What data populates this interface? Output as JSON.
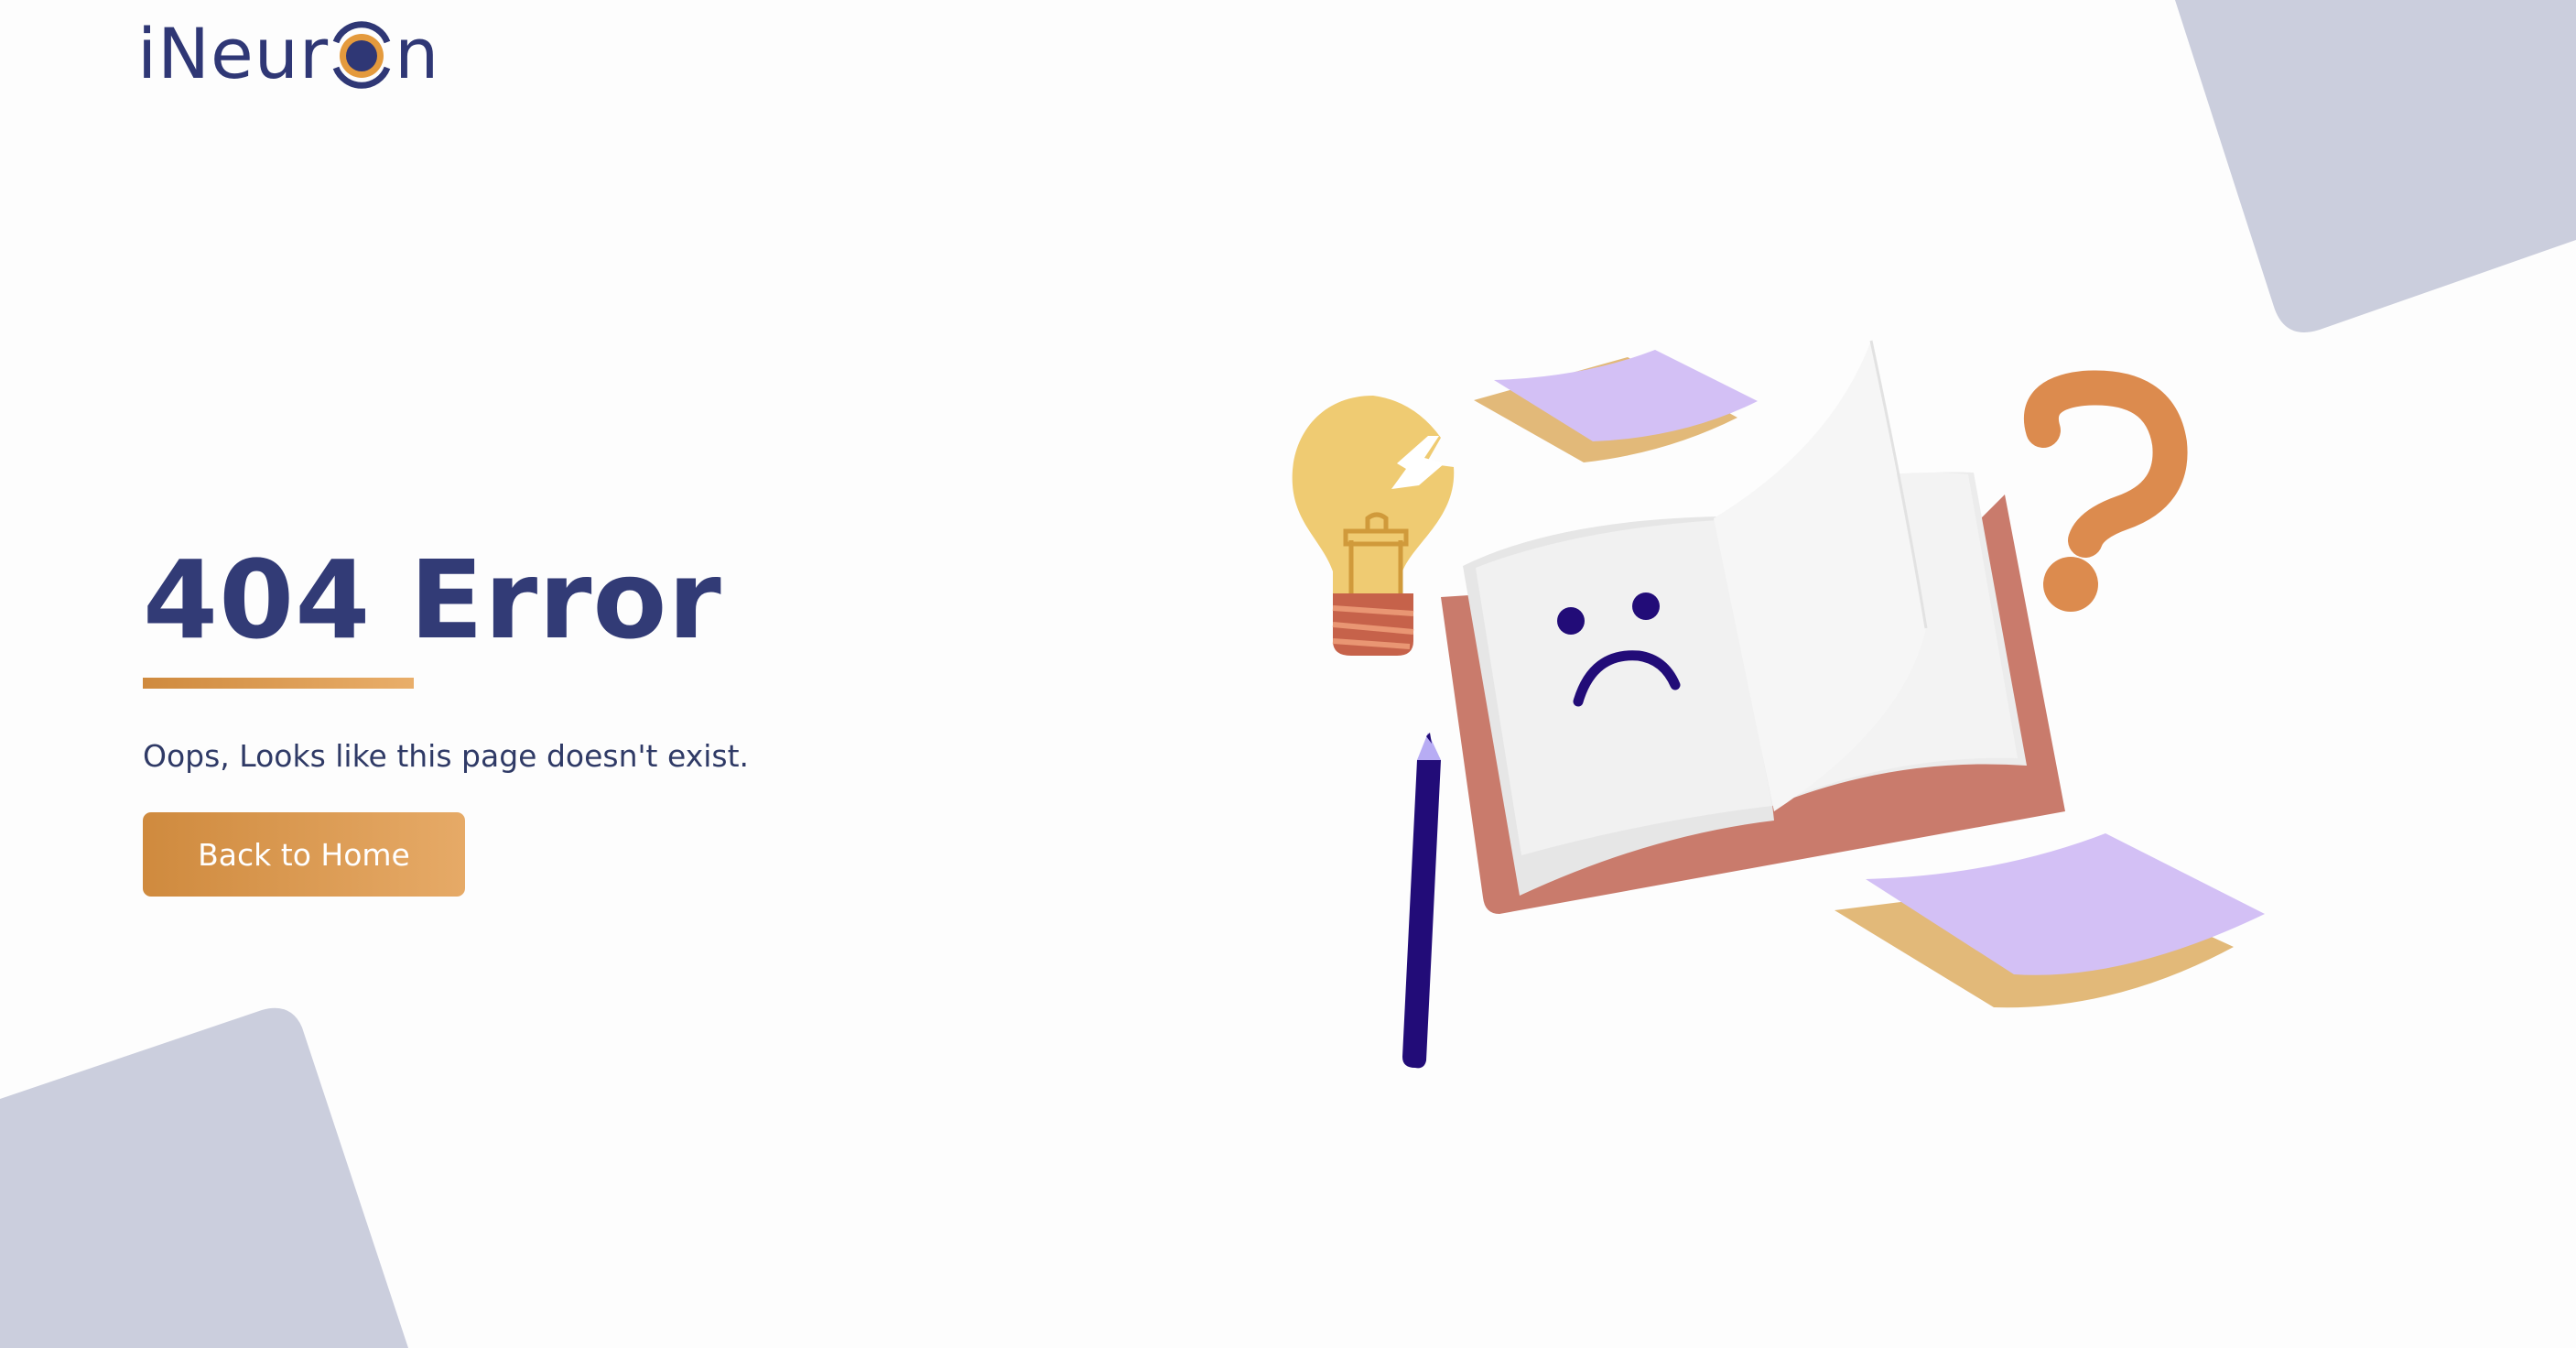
{
  "brand": {
    "logo_text_start": "iNeur",
    "logo_text_end": "n"
  },
  "error": {
    "title": "404 Error",
    "message": "Oops, Looks like this page doesn't exist.",
    "button_label": "Back to Home"
  },
  "colors": {
    "primary_text": "#323b76",
    "accent_start": "#cf8a3e",
    "accent_end": "#e6aa67",
    "background": "#fdfdfd",
    "corner_shape": "#cbcedd"
  },
  "illustration": {
    "icons": [
      "lightbulb-icon",
      "sticky-note-icon",
      "open-book-icon",
      "sad-face-icon",
      "pencil-icon",
      "question-mark-icon"
    ]
  }
}
